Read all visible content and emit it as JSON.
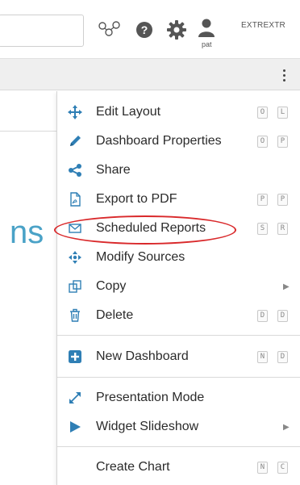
{
  "header": {
    "user_name": "pat",
    "account_label": "EXTREXTR"
  },
  "menu": {
    "items": [
      {
        "label": "Edit Layout",
        "icon": "move-arrows-icon",
        "shortcut": [
          "O",
          "L"
        ]
      },
      {
        "label": "Dashboard Properties",
        "icon": "pencil-icon",
        "shortcut": [
          "O",
          "P"
        ]
      },
      {
        "label": "Share",
        "icon": "share-icon",
        "shortcut": []
      },
      {
        "label": "Export to PDF",
        "icon": "pdf-file-icon",
        "shortcut": [
          "P",
          "P"
        ]
      },
      {
        "label": "Scheduled Reports",
        "icon": "envelope-icon",
        "shortcut": [
          "S",
          "R"
        ]
      },
      {
        "label": "Modify Sources",
        "icon": "four-arrows-icon",
        "shortcut": []
      },
      {
        "label": "Copy",
        "icon": "copy-icon",
        "shortcut": []
      },
      {
        "label": "Delete",
        "icon": "trash-icon",
        "shortcut": [
          "D",
          "D"
        ]
      },
      {
        "label": "New Dashboard",
        "icon": "plus-square-icon",
        "shortcut": [
          "N",
          "D"
        ]
      },
      {
        "label": "Presentation Mode",
        "icon": "expand-icon",
        "shortcut": []
      },
      {
        "label": "Widget Slideshow",
        "icon": "play-icon",
        "shortcut": []
      },
      {
        "label": "Create Chart",
        "icon": "none",
        "shortcut": [
          "N",
          "C"
        ]
      }
    ]
  },
  "colors": {
    "accent_blue": "#2f7fb5",
    "highlight_red": "#d9292b",
    "title_blue": "#4aa2c7"
  },
  "content": {
    "title_fragment": "ns"
  }
}
